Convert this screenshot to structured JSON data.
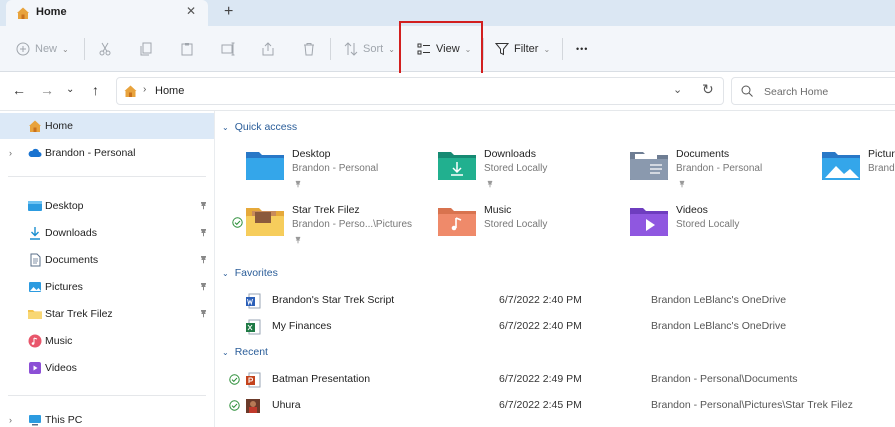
{
  "tab": {
    "title": "Home",
    "close": "✕",
    "new_tab": "+"
  },
  "toolbar": {
    "new_label": "New",
    "sort_label": "Sort",
    "view_label": "View",
    "filter_label": "Filter",
    "more_label": "•••"
  },
  "address": {
    "path": "Home",
    "search_placeholder": "Search Home"
  },
  "sidebar": {
    "items": [
      {
        "label": "Home"
      },
      {
        "label": "Brandon - Personal"
      },
      {
        "label": "Desktop"
      },
      {
        "label": "Downloads"
      },
      {
        "label": "Documents"
      },
      {
        "label": "Pictures"
      },
      {
        "label": "Star Trek Filez"
      },
      {
        "label": "Music"
      },
      {
        "label": "Videos"
      },
      {
        "label": "This PC"
      }
    ]
  },
  "sections": {
    "quick_access": "Quick access",
    "favorites": "Favorites",
    "recent": "Recent"
  },
  "quick_access": [
    {
      "name": "Desktop",
      "sub": "Brandon - Personal"
    },
    {
      "name": "Downloads",
      "sub": "Stored Locally"
    },
    {
      "name": "Documents",
      "sub": "Brandon - Personal"
    },
    {
      "name": "Pictures",
      "sub": "Brando"
    },
    {
      "name": "Star Trek Filez",
      "sub": "Brandon - Perso...\\Pictures"
    },
    {
      "name": "Music",
      "sub": "Stored Locally"
    },
    {
      "name": "Videos",
      "sub": "Stored Locally"
    }
  ],
  "favorites": [
    {
      "name": "Brandon's Star Trek Script",
      "date": "6/7/2022 2:40 PM",
      "location": "Brandon LeBlanc's OneDrive",
      "icon": "word-icon"
    },
    {
      "name": "My Finances",
      "date": "6/7/2022 2:40 PM",
      "location": "Brandon LeBlanc's OneDrive",
      "icon": "excel-icon"
    }
  ],
  "recent": [
    {
      "name": "Batman Presentation",
      "date": "6/7/2022 2:49 PM",
      "location": "Brandon - Personal\\Documents",
      "icon": "powerpoint-icon"
    },
    {
      "name": "Uhura",
      "date": "6/7/2022 2:45 PM",
      "location": "Brandon - Personal\\Pictures\\Star Trek Filez",
      "icon": "image-icon"
    }
  ],
  "colors": {
    "accent": "#2a5d99",
    "highlight_box": "#d21f1f",
    "selected_bg": "#dce9f7"
  }
}
